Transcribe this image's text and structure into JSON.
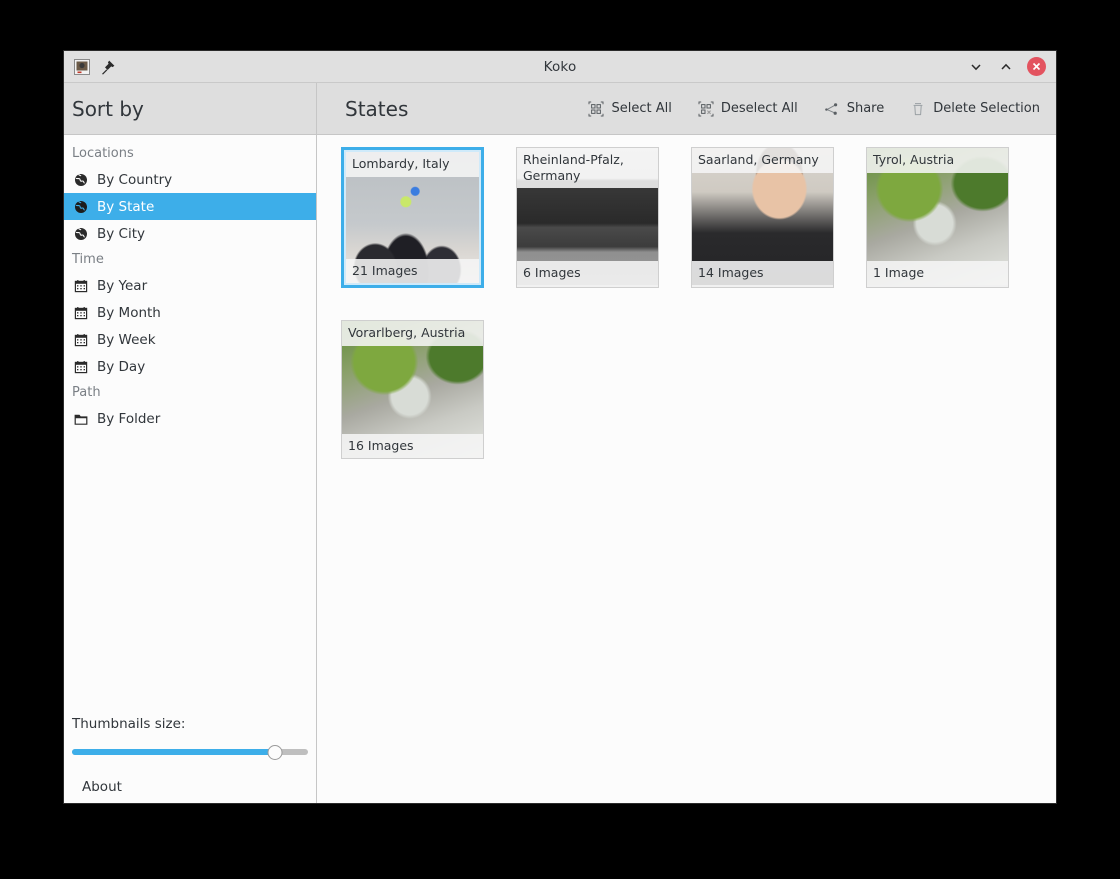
{
  "window": {
    "title": "Koko",
    "app_icon": "photo-icon",
    "pin_icon": "pin-icon",
    "controls": {
      "minimize": "chevron-down-icon",
      "maximize": "chevron-up-icon",
      "close": "close-icon"
    }
  },
  "header": {
    "sort_by_title": "Sort by",
    "section_title": "States",
    "actions": [
      {
        "label": "Select All",
        "icon": "select-all-icon"
      },
      {
        "label": "Deselect All",
        "icon": "deselect-all-icon"
      },
      {
        "label": "Share",
        "icon": "share-icon"
      },
      {
        "label": "Delete Selection",
        "icon": "trash-icon"
      }
    ]
  },
  "sidebar": {
    "groups": [
      {
        "label": "Locations",
        "items": [
          {
            "label": "By Country",
            "icon": "globe-icon",
            "selected": false
          },
          {
            "label": "By State",
            "icon": "globe-icon",
            "selected": true
          },
          {
            "label": "By City",
            "icon": "globe-icon",
            "selected": false
          }
        ]
      },
      {
        "label": "Time",
        "items": [
          {
            "label": "By Year",
            "icon": "calendar-icon",
            "selected": false
          },
          {
            "label": "By Month",
            "icon": "calendar-icon",
            "selected": false
          },
          {
            "label": "By Week",
            "icon": "calendar-icon",
            "selected": false
          },
          {
            "label": "By Day",
            "icon": "calendar-icon",
            "selected": false
          }
        ]
      },
      {
        "label": "Path",
        "items": [
          {
            "label": "By Folder",
            "icon": "folder-icon",
            "selected": false
          }
        ]
      }
    ],
    "footer": {
      "thumbnails_size_label": "Thumbnails size:",
      "slider_percent": 86,
      "about_label": "About"
    }
  },
  "content": {
    "cards": [
      {
        "title": "Lombardy, Italy",
        "count": "21 Images",
        "selected": true,
        "photo": "ph-lecture"
      },
      {
        "title": "Rheinland-Pfalz, Germany",
        "count": "6 Images",
        "selected": false,
        "photo": "ph-monument"
      },
      {
        "title": "Saarland, Germany",
        "count": "14 Images",
        "selected": false,
        "photo": "ph-portrait"
      },
      {
        "title": "Tyrol, Austria",
        "count": "1 Image",
        "selected": false,
        "photo": "ph-waterfall"
      },
      {
        "title": "Vorarlberg, Austria",
        "count": "16 Images",
        "selected": false,
        "photo": "ph-waterfall"
      }
    ]
  },
  "colors": {
    "accent": "#3daee9",
    "close": "#e3535f",
    "text": "#31363b",
    "muted": "#7a7f85"
  }
}
